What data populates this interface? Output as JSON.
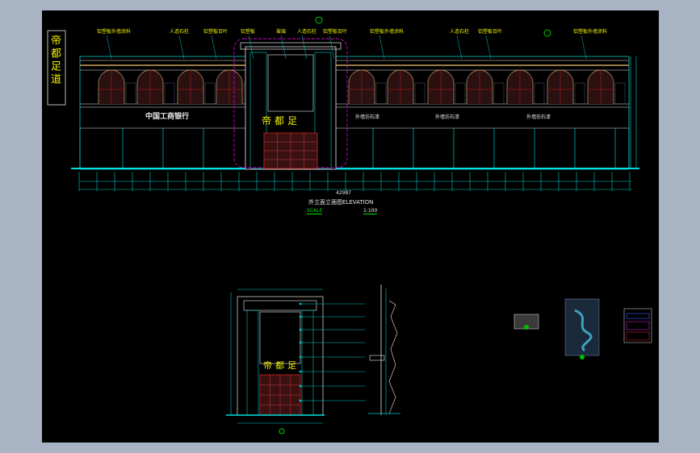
{
  "drawing": {
    "main_title": "外立面立面图ELEVATION",
    "scale_label": "SCALE",
    "scale_value": "1:100",
    "sign_text": "帝都足",
    "vertical_sign": "帝都足道",
    "logo_text": "中国工商银行",
    "annotations_top": [
      "铝塑板外墙涂料",
      "人造石柱",
      "铝塑板百叶",
      "铝塑板",
      "玻璃",
      "人造石柱",
      "铝塑板百叶",
      "铝塑板外墙涂料",
      "人造石柱",
      "铝塑板百叶",
      "铝塑板外墙涂料"
    ],
    "facade_labels": [
      "外墙仿石漆",
      "外墙仿石漆",
      "外墙仿石漆"
    ],
    "total_dim": "42987"
  },
  "colors": {
    "background": "#000000",
    "frame": "#a8b4c4",
    "cad_cyan": "#00c8c8",
    "cad_yellow": "#f0f000",
    "cad_magenta": "#d000d0",
    "cad_red": "#c02020",
    "cad_white": "#e8e8e8"
  }
}
